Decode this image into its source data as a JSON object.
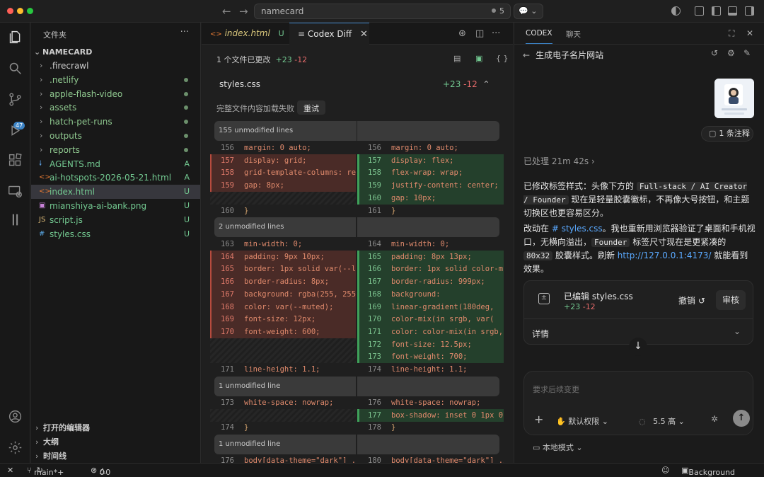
{
  "titlebar": {
    "search": "namecard",
    "badge": "5"
  },
  "explorer": {
    "header": "文件夹",
    "more": "···",
    "root": "NAMECARD",
    "items": [
      {
        "name": ".firecrawl",
        "type": "folder",
        "mark": "",
        "dot": false
      },
      {
        "name": ".netlify",
        "type": "folder",
        "mark": "",
        "dot": true
      },
      {
        "name": "apple-flash-video",
        "type": "folder",
        "mark": "",
        "dot": true
      },
      {
        "name": "assets",
        "type": "folder",
        "mark": "",
        "dot": true
      },
      {
        "name": "hatch-pet-runs",
        "type": "folder",
        "mark": "",
        "dot": true
      },
      {
        "name": "outputs",
        "type": "folder",
        "mark": "",
        "dot": true
      },
      {
        "name": "reports",
        "type": "folder",
        "mark": "",
        "dot": true
      },
      {
        "name": "AGENTS.md",
        "type": "md",
        "mark": "A",
        "dot": false
      },
      {
        "name": "ai-hotspots-2026-05-21.html",
        "type": "html",
        "mark": "A",
        "dot": false
      },
      {
        "name": "index.html",
        "type": "html",
        "mark": "U",
        "dot": false
      },
      {
        "name": "mianshiya-ai-bank.png",
        "type": "png",
        "mark": "U",
        "dot": false
      },
      {
        "name": "script.js",
        "type": "js",
        "mark": "U",
        "dot": false
      },
      {
        "name": "styles.css",
        "type": "css",
        "mark": "U",
        "dot": false
      }
    ],
    "sections": [
      "打开的编辑器",
      "大纲",
      "时间线"
    ]
  },
  "activity": {
    "scm_badge": "47"
  },
  "tabs": [
    {
      "label": "index.html",
      "status": "U"
    },
    {
      "label": "Codex Diff",
      "close": "✕"
    }
  ],
  "diff": {
    "summary_text": "1 个文件已更改",
    "summary_plus": "+23",
    "summary_minus": "-12",
    "file": "styles.css",
    "file_plus": "+23",
    "file_minus": "-12",
    "load_fail": "完整文件内容加载失败",
    "retry": "重试",
    "folds": [
      "155 unmodified lines",
      "2 unmodified lines",
      "1 unmodified line",
      "1 unmodified line"
    ],
    "hunk1_left": [
      {
        "n": "156",
        "code": "margin: 0 auto;",
        "t": "ctx"
      },
      {
        "n": "157",
        "code": "display: grid;",
        "t": "del"
      },
      {
        "n": "158",
        "code": "grid-template-columns: re",
        "t": "del"
      },
      {
        "n": "159",
        "code": "gap: 8px;",
        "t": "del"
      },
      {
        "n": "160",
        "code": "}",
        "t": "ctx"
      }
    ],
    "hunk1_right": [
      {
        "n": "156",
        "code": "margin: 0 auto;",
        "t": "ctx"
      },
      {
        "n": "157",
        "code": "display: flex;",
        "t": "add"
      },
      {
        "n": "158",
        "code": "flex-wrap: wrap;",
        "t": "add"
      },
      {
        "n": "159",
        "code": "justify-content: center;",
        "t": "add"
      },
      {
        "n": "160",
        "code": "gap: 10px;",
        "t": "add"
      },
      {
        "n": "161",
        "code": "}",
        "t": "ctx"
      }
    ],
    "hunk2_left": [
      {
        "n": "163",
        "code": "min-width: 0;",
        "t": "ctx"
      },
      {
        "n": "164",
        "code": "padding: 9px 10px;",
        "t": "del"
      },
      {
        "n": "165",
        "code": "border: 1px solid var(--l",
        "t": "del"
      },
      {
        "n": "166",
        "code": "border-radius: 8px;",
        "t": "del"
      },
      {
        "n": "167",
        "code": "background: rgba(255, 255",
        "t": "del"
      },
      {
        "n": "168",
        "code": "color: var(--muted);",
        "t": "del"
      },
      {
        "n": "169",
        "code": "font-size: 12px;",
        "t": "del"
      },
      {
        "n": "170",
        "code": "font-weight: 600;",
        "t": "del"
      },
      {
        "n": "171",
        "code": "line-height: 1.1;",
        "t": "ctx"
      }
    ],
    "hunk2_right": [
      {
        "n": "164",
        "code": "min-width: 0;",
        "t": "ctx"
      },
      {
        "n": "165",
        "code": "padding: 8px 13px;",
        "t": "add"
      },
      {
        "n": "166",
        "code": "border: 1px solid color-m",
        "t": "add"
      },
      {
        "n": "167",
        "code": "border-radius: 999px;",
        "t": "add"
      },
      {
        "n": "168",
        "code": "background:",
        "t": "add"
      },
      {
        "n": "169",
        "code": "  linear-gradient(180deg,",
        "t": "add"
      },
      {
        "n": "170",
        "code": "  color-mix(in srgb, var(",
        "t": "add"
      },
      {
        "n": "171",
        "code": "color: color-mix(in srgb,",
        "t": "add"
      },
      {
        "n": "172",
        "code": "font-size: 12.5px;",
        "t": "add"
      },
      {
        "n": "173",
        "code": "font-weight: 700;",
        "t": "add"
      },
      {
        "n": "174",
        "code": "line-height: 1.1;",
        "t": "ctx"
      }
    ],
    "hunk3_left": [
      {
        "n": "173",
        "code": "white-space: nowrap;",
        "t": "ctx"
      },
      {
        "n": "174",
        "code": "}",
        "t": "ctx"
      }
    ],
    "hunk3_right": [
      {
        "n": "176",
        "code": "white-space: nowrap;",
        "t": "ctx"
      },
      {
        "n": "177",
        "code": "box-shadow: inset 0 1px 0",
        "t": "add"
      },
      {
        "n": "178",
        "code": "}",
        "t": "ctx"
      }
    ],
    "hunk4_left": [
      {
        "n": "176",
        "code": "body[data-theme=\"dark\"] .ic",
        "t": "ctx"
      }
    ],
    "hunk4_right": [
      {
        "n": "180",
        "code": "body[data-theme=\"dark\"] .ic",
        "t": "ctx"
      }
    ]
  },
  "panel": {
    "tabs": [
      "CODEX",
      "聊天"
    ],
    "title": "生成电子名片网站",
    "annotation": "1 条注释",
    "processed": "已处理 21m 42s",
    "msg1_a": "已修改标签样式：头像下方的 ",
    "msg1_chip": "Full-stack / AI Creator / Founder",
    "msg1_b": " 现在是轻量胶囊徽标，不再像大号按钮，和主题切换区也更容易区分。",
    "msg2_a": "改动在 ",
    "msg2_link": "# styles.css",
    "msg2_b": "。我也重新用浏览器验证了桌面和手机视口，无横向溢出，",
    "msg2_chip1": "Founder",
    "msg2_c": " 标签尺寸现在是更紧凑的 ",
    "msg2_chip2": "80x32",
    "msg2_d": " 胶囊样式。刷新 ",
    "msg2_link2": "http://127.0.0.1:4173/",
    "msg2_e": " 就能看到效果。",
    "edit_title": "已编辑 styles.css",
    "edit_plus": "+23",
    "edit_minus": "-12",
    "undo": "撤销",
    "review": "审核",
    "details": "详情",
    "placeholder": "要求后续变更",
    "permission": "默认权限",
    "model": "5.5 高",
    "local_mode": "本地模式"
  },
  "status": {
    "branch": "main*+",
    "errors": "0",
    "warnings": "0",
    "background": "Background"
  }
}
